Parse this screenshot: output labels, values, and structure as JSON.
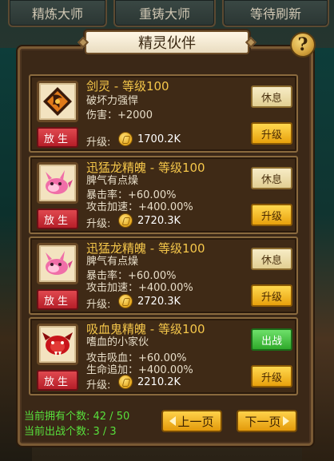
{
  "top_tabs": [
    "精炼大师",
    "重铸大师",
    "等待刷新"
  ],
  "panel": {
    "title": "精灵伙伴",
    "help_label": "?"
  },
  "cards": [
    {
      "name": "剑灵 - 等级100",
      "desc_lines": [
        "破坏力强悍",
        "伤害：+2000"
      ],
      "upgrade_label": "升级:",
      "cost": "1700.2K",
      "release_label": "放生",
      "state_label": "休息",
      "state": "rest",
      "upgrade_button": "升级",
      "icon": "sword-spirit-icon"
    },
    {
      "name": "迅猛龙精魄 - 等级100",
      "desc_lines": [
        "脾气有点燥",
        "暴击率：+60.00%",
        "攻击加速：+400.00%"
      ],
      "upgrade_label": "升级:",
      "cost": "2720.3K",
      "release_label": "放生",
      "state_label": "休息",
      "state": "rest",
      "upgrade_button": "升级",
      "icon": "pink-dragon-icon"
    },
    {
      "name": "迅猛龙精魄 - 等级100",
      "desc_lines": [
        "脾气有点燥",
        "暴击率：+60.00%",
        "攻击加速：+400.00%"
      ],
      "upgrade_label": "升级:",
      "cost": "2720.3K",
      "release_label": "放生",
      "state_label": "休息",
      "state": "rest",
      "upgrade_button": "升级",
      "icon": "pink-dragon-icon"
    },
    {
      "name": "吸血鬼精魄 - 等级100",
      "desc_lines": [
        "嗜血的小家伙",
        "攻击吸血：+60.00%",
        "生命追加：+400.00%"
      ],
      "upgrade_label": "升级:",
      "cost": "2210.2K",
      "release_label": "放生",
      "state_label": "出战",
      "state": "active",
      "upgrade_button": "升级",
      "icon": "red-vampire-icon"
    }
  ],
  "footer": {
    "owned": "当前拥有个数:  42 / 50",
    "deployed": "当前出战个数:  3 / 3",
    "prev": "上一页",
    "next": "下一页"
  },
  "colors": {
    "name": "#f4c64a",
    "footer": "#58e03c",
    "release": "#c9262f"
  }
}
